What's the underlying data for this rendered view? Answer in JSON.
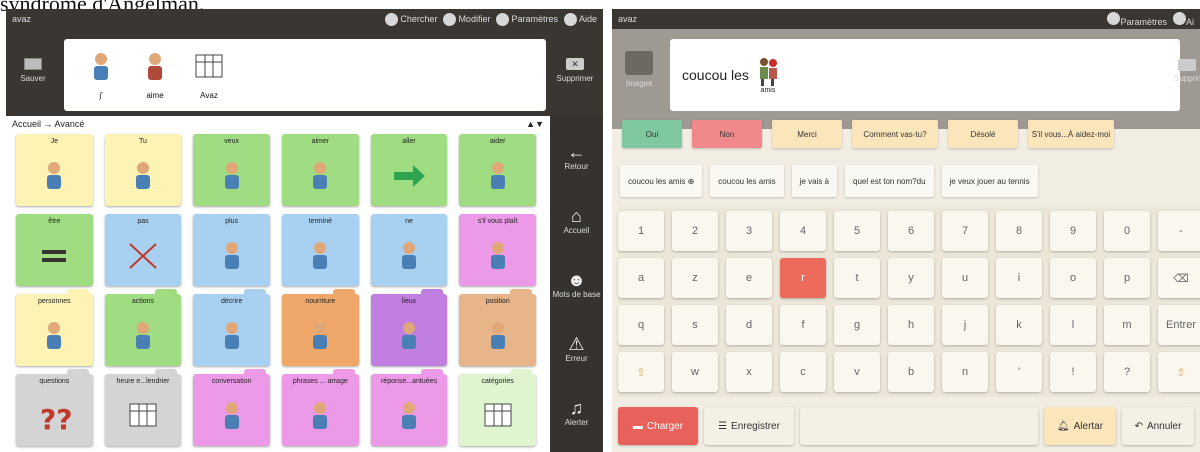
{
  "caption": "syndrome d'Angelman.",
  "left": {
    "app_name": "avaz",
    "toolbar": [
      {
        "label": "Chercher",
        "icon": "search-icon"
      },
      {
        "label": "Modifier",
        "icon": "edit-icon"
      },
      {
        "label": "Paramètres",
        "icon": "gear-icon"
      },
      {
        "label": "Aide",
        "icon": "help-icon"
      }
    ],
    "save_label": "Sauver",
    "delete_label": "Supprimer",
    "message_words": [
      {
        "word": "j'",
        "icon": "person-boy-icon"
      },
      {
        "word": "aime",
        "icon": "love-icon"
      },
      {
        "word": "Avaz",
        "icon": "tablet-icon"
      }
    ],
    "breadcrumb": "Accueil → Avancé",
    "grid": [
      {
        "label": "Je",
        "icon": "person-icon",
        "color": "#fdf3b4",
        "folder": false
      },
      {
        "label": "Tu",
        "icon": "you-icon",
        "color": "#fdf3b4",
        "folder": false
      },
      {
        "label": "veux",
        "icon": "want-icon",
        "color": "#9fdc82",
        "folder": false
      },
      {
        "label": "aimer",
        "icon": "love-icon",
        "color": "#9fdc82",
        "folder": false
      },
      {
        "label": "aller",
        "icon": "arrow-right-icon",
        "color": "#9fdc82",
        "folder": false
      },
      {
        "label": "aider",
        "icon": "help-people-icon",
        "color": "#9fdc82",
        "folder": false
      },
      {
        "label": "être",
        "icon": "equals-icon",
        "color": "#9fdc82",
        "folder": false
      },
      {
        "label": "pas",
        "icon": "cross-icon",
        "color": "#a8d0f0",
        "folder": false
      },
      {
        "label": "plus",
        "icon": "more-icon",
        "color": "#a8d0f0",
        "folder": false
      },
      {
        "label": "terminé",
        "icon": "finished-icon",
        "color": "#a8d0f0",
        "folder": false
      },
      {
        "label": "ne",
        "icon": "not-icon",
        "color": "#a8d0f0",
        "folder": false
      },
      {
        "label": "s'il vous plaît",
        "icon": "please-icon",
        "color": "#ec9ae8",
        "folder": false
      },
      {
        "label": "personnes",
        "icon": "people-icon",
        "color": "#fdf3b4",
        "folder": true
      },
      {
        "label": "actions",
        "icon": "actions-icon",
        "color": "#9fdc82",
        "folder": true
      },
      {
        "label": "décrire",
        "icon": "describe-icon",
        "color": "#a8d0f0",
        "folder": true
      },
      {
        "label": "nourriture",
        "icon": "food-icon",
        "color": "#f0a86a",
        "folder": true
      },
      {
        "label": "lieux",
        "icon": "places-icon",
        "color": "#c07ee0",
        "folder": true
      },
      {
        "label": "position",
        "icon": "position-icon",
        "color": "#e8b48a",
        "folder": true
      },
      {
        "label": "questions",
        "icon": "question-icon",
        "color": "#d4d4d4",
        "folder": true
      },
      {
        "label": "heure e...lendrier",
        "icon": "calendar-icon",
        "color": "#d4d4d4",
        "folder": true
      },
      {
        "label": "conversation",
        "icon": "conversation-icon",
        "color": "#ec9ae8",
        "folder": true
      },
      {
        "label": "phrases ... arrage",
        "icon": "phrases-icon",
        "color": "#ec9ae8",
        "folder": true
      },
      {
        "label": "réponse...antuées",
        "icon": "reply-icon",
        "color": "#ec9ae8",
        "folder": true
      },
      {
        "label": "catégories",
        "icon": "categories-icon",
        "color": "#dff5d0",
        "folder": true
      }
    ],
    "nav": [
      {
        "label": "Retour",
        "icon": "back-arrow-icon",
        "glyph": "←"
      },
      {
        "label": "Accueil",
        "icon": "home-icon",
        "glyph": "⌂"
      },
      {
        "label": "Mots de base",
        "icon": "speaking-head-icon",
        "glyph": "☻"
      },
      {
        "label": "Erreur",
        "icon": "warning-icon",
        "glyph": "⚠"
      },
      {
        "label": "Alerter",
        "icon": "bell-icon",
        "glyph": "♫"
      }
    ]
  },
  "right": {
    "app_name": "avaz",
    "toolbar": [
      {
        "label": "Paramètres",
        "icon": "gear-icon"
      },
      {
        "label": "Ai",
        "icon": "help-icon"
      }
    ],
    "image_label": "Images",
    "delete_label": "Supprim",
    "message_text": "coucou les",
    "message_symbol_label": "amis",
    "quick_chips": [
      {
        "label": "Oui",
        "color": "#7fc8a0"
      },
      {
        "label": "Non",
        "color": "#f08a8a"
      },
      {
        "label": "Merci",
        "color": "#fbe6bb"
      },
      {
        "label": "Comment vas-tu?",
        "color": "#fbe6bb"
      },
      {
        "label": "Désolé",
        "color": "#fbe6bb"
      },
      {
        "label": "S'il vous...À aidez-moi",
        "color": "#fbe6bb"
      }
    ],
    "phrases": [
      "coucou les amis ⊕",
      "coucou les amis",
      "je vais à",
      "quel est ton nom?du",
      "je veux jouer au tennis"
    ],
    "keyboard": {
      "row1": [
        "1",
        "2",
        "3",
        "4",
        "5",
        "6",
        "7",
        "8",
        "9",
        "0",
        "-"
      ],
      "row2": [
        "a",
        "z",
        "e",
        "r",
        "t",
        "y",
        "u",
        "i",
        "o",
        "p",
        "⌫"
      ],
      "row3": [
        "q",
        "s",
        "d",
        "f",
        "g",
        "h",
        "j",
        "k",
        "l",
        "m",
        "Entrer"
      ],
      "row4": [
        "⇧",
        "w",
        "x",
        "c",
        "v",
        "b",
        "n",
        "'",
        "!",
        "?",
        "⇧"
      ],
      "highlight": "r"
    },
    "bottom": {
      "charger": "Charger",
      "enregistrer": "Enregistrer",
      "alerter": "Alertar",
      "annuler": "Annuler"
    },
    "colors": {
      "charger": "#e8615a",
      "alerter": "#fbe6bb"
    }
  }
}
